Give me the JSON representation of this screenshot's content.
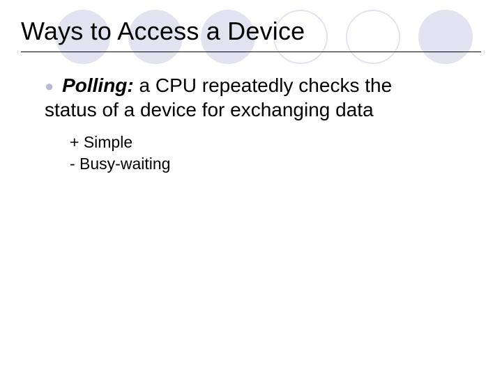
{
  "slide": {
    "title": "Ways to Access a Device",
    "bullet": {
      "term": "Polling:",
      "definition_line1": "  a CPU repeatedly checks the",
      "definition_line2": "status of a device for exchanging data"
    },
    "sub": {
      "pro": "+ Simple",
      "con": "- Busy-waiting"
    }
  }
}
